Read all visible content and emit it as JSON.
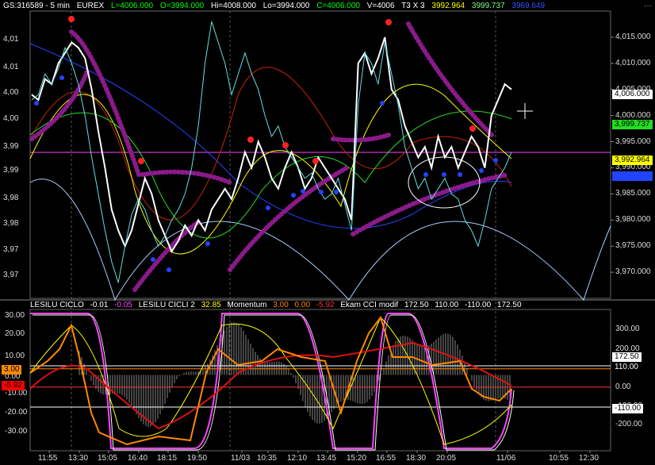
{
  "header": {
    "symbol": "GS:316589 - 5 min",
    "exchange": "EUREX",
    "last": "L=4006.000",
    "open": "O=3994.000",
    "high": "Hi=4008.000",
    "low": "Lo=3994.000",
    "close": "C=4006.000",
    "volume": "V=4006",
    "study": "T3 X 3",
    "val1": "3992.964",
    "val2": "3999.737",
    "val3": "3969.649",
    "colors": {
      "symbol": "#ffffff",
      "exchange": "#ffffff",
      "last": "#00ff00",
      "open": "#00ff00",
      "high": "#ffffff",
      "low": "#ffffff",
      "close": "#00ff00",
      "volume": "#ffffff",
      "study": "#ffffff",
      "val1": "#ffff00",
      "val2": "#7fff7f",
      "val3": "#3355ff"
    }
  },
  "sub_header": {
    "name1": "LESILU CICLO",
    "v1": "-0.01",
    "v2": "-0.05",
    "name2": "LESILU CICLI 2",
    "v3": "32.85",
    "name3": "Momentum",
    "v4": "3.00",
    "v5": "0.00",
    "v6": "-5.92",
    "name4": "Ekam CCI modif",
    "v7": "172.50",
    "v8": "110.00",
    "v9": "-110.00",
    "v10": "172.50",
    "colors": {
      "name1": "#ffffff",
      "v1": "#ffffff",
      "v2": "#ff44ff",
      "name2": "#ffffff",
      "v3": "#ffff00",
      "name3": "#ffffff",
      "v4": "#ff8800",
      "v5": "#ff8800",
      "v6": "#ff3333",
      "name4": "#ffffff",
      "v7": "#ffffff",
      "v8": "#ffffff",
      "v9": "#ffffff",
      "v10": "#ffffff"
    }
  },
  "price_axis_right": [
    "4,015.000",
    "4,010.000",
    "4,005.000",
    "4,000.000",
    "3,995.000",
    "3,990.000",
    "3,985.000",
    "3,980.000",
    "3,975.000",
    "3,970.000"
  ],
  "price_axis_left": [
    "4,01",
    "4,01",
    "4,00",
    "4,00",
    "3,99",
    "3,99",
    "3,98",
    "3,98",
    "3,97",
    "3,97"
  ],
  "price_tags": [
    {
      "text": "4,006.000",
      "bg": "#ffffff",
      "fg": "#000000"
    },
    {
      "text": "3,999.737",
      "bg": "#22dd22",
      "fg": "#000000"
    },
    {
      "text": "3,992.964",
      "bg": "#ffff00",
      "fg": "#000000"
    },
    {
      "text": "3,989.649",
      "bg": "#2244ff",
      "fg": "#2244ff"
    }
  ],
  "osc_axis_left": [
    "30.00",
    "20.00",
    "10.00",
    "0.00",
    "-10.00",
    "-20.00",
    "-30.00"
  ],
  "osc_axis_right": [
    "300.00",
    "200.00",
    "100.00",
    "0.00",
    "-100.00",
    "-200.00"
  ],
  "osc_left_tags": [
    {
      "text": "3.00",
      "bg": "#ff8800",
      "fg": "#000000"
    },
    {
      "text": "-5.92",
      "bg": "#ff0000",
      "fg": "#000000"
    }
  ],
  "osc_right_tags": [
    {
      "text": "172.50",
      "bg": "#ffffff",
      "fg": "#000000"
    },
    {
      "text": "110.00",
      "bg": "#000000",
      "fg": "#ffffff"
    },
    {
      "text": "-110.00",
      "bg": "#ffffff",
      "fg": "#000000"
    }
  ],
  "time_axis": [
    "11:55",
    "13:30",
    "15:05",
    "16:40",
    "18:15",
    "19:50",
    "11/03",
    "10:35",
    "12:10",
    "13:45",
    "15:20",
    "16:55",
    "18:30",
    "20:05",
    "11/06",
    "10:55",
    "12:30"
  ],
  "chart_data": {
    "type": "line",
    "instrument": "GS:316589",
    "interval": "5 min",
    "price_ylim": [
      3965,
      4020
    ],
    "horizontal_level": 3992.964,
    "last_price": 4006.0,
    "price_series": [
      {
        "name": "price-white",
        "color": "#ffffff",
        "values": [
          4004,
          4003,
          4007,
          4006,
          4010,
          4012,
          4014,
          4013,
          4011,
          4005,
          3997,
          3990,
          3982,
          3978,
          3975,
          3978,
          3983,
          3988,
          3985,
          3980,
          3977,
          3974,
          3976,
          3979,
          3977,
          3980,
          3978,
          3982,
          3984,
          3986,
          3984,
          3988,
          3993,
          3990,
          3995,
          3992,
          3988,
          3986,
          3990,
          3993,
          3990,
          3986,
          3988,
          3992,
          3990,
          3988,
          3986,
          3984,
          3980,
          4010,
          4012,
          4008,
          4011,
          4015,
          4005,
          4003,
          3998,
          3995,
          3992,
          3994,
          3990,
          3996,
          3992,
          3994,
          3990,
          3993,
          3996,
          3994,
          3990,
          4000,
          4003,
          4006,
          4005
        ]
      },
      {
        "name": "price-cyan",
        "color": "#66dddd",
        "values": [
          4003,
          4004,
          4008,
          4006,
          4009,
          4013,
          4010,
          4006,
          4000,
          3992,
          3985,
          3978,
          3972,
          3968,
          3975,
          3981,
          3984,
          3982,
          3978,
          3975,
          3977,
          3980,
          3982,
          3985,
          3990,
          3998,
          4010,
          4018,
          4014,
          4010,
          4004,
          4008,
          4012,
          4008,
          4005,
          4000,
          3996,
          3998,
          3994,
          3992,
          3990,
          3988,
          3989,
          3986,
          3984,
          3985,
          3988,
          3983,
          3978,
          4002,
          4012,
          4010,
          4006,
          4014,
          4008,
          4002,
          3994,
          3990,
          3986,
          3988,
          3984,
          3986,
          3988,
          3985,
          3984,
          3980,
          3978,
          3975,
          3980,
          3986,
          3988,
          3990,
          3993
        ]
      }
    ],
    "osc_ylim": [
      -37,
      32
    ],
    "osc_levels": [
      3.0,
      -5.92
    ],
    "cci_levels": [
      172.5,
      110.0,
      -110.0
    ]
  }
}
